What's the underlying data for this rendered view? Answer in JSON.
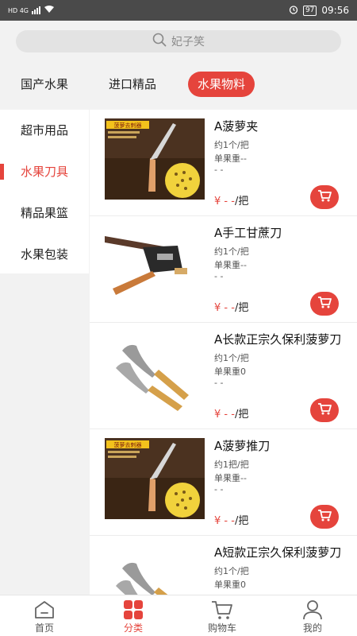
{
  "status_bar": {
    "network": "HD 4G",
    "battery": "97",
    "time": "09:56"
  },
  "search": {
    "placeholder": "妃子笑"
  },
  "top_tabs": [
    {
      "label": "国产水果",
      "active": false
    },
    {
      "label": "进口精品",
      "active": false
    },
    {
      "label": "水果物料",
      "active": true
    }
  ],
  "sidebar": [
    {
      "label": "超市用品",
      "active": false
    },
    {
      "label": "水果刀具",
      "active": true
    },
    {
      "label": "精品果篮",
      "active": false
    },
    {
      "label": "水果包装",
      "active": false
    }
  ],
  "products": [
    {
      "name": "A菠萝夹",
      "spec": "约1个/把",
      "weight": "单果重--",
      "note": "- -",
      "price_symbol": "¥",
      "price": " - -",
      "unit": "/把",
      "image_text": "菠萝去刺器"
    },
    {
      "name": "A手工甘蔗刀",
      "spec": "约1个/把",
      "weight": "单果重--",
      "note": "- -",
      "price_symbol": "¥",
      "price": " - -",
      "unit": "/把"
    },
    {
      "name": "A长款正宗久保利菠萝刀",
      "spec": "约1个/把",
      "weight": "单果重0",
      "note": "- -",
      "price_symbol": "¥",
      "price": " - -",
      "unit": "/把"
    },
    {
      "name": "A菠萝推刀",
      "spec": "约1把/把",
      "weight": "单果重--",
      "note": "- -",
      "price_symbol": "¥",
      "price": " - -",
      "unit": "/把",
      "image_text": "菠萝去刺器"
    },
    {
      "name": "A短款正宗久保利菠萝刀",
      "spec": "约1个/把",
      "weight": "单果重0",
      "note": "",
      "price_symbol": "",
      "price": "",
      "unit": ""
    }
  ],
  "bottom_nav": [
    {
      "label": "首页",
      "icon": "home-icon",
      "active": false
    },
    {
      "label": "分类",
      "icon": "category-icon",
      "active": true
    },
    {
      "label": "购物车",
      "icon": "cart-icon",
      "active": false
    },
    {
      "label": "我的",
      "icon": "user-icon",
      "active": false
    }
  ],
  "colors": {
    "accent": "#e5443c",
    "background": "#f2f2f2"
  }
}
